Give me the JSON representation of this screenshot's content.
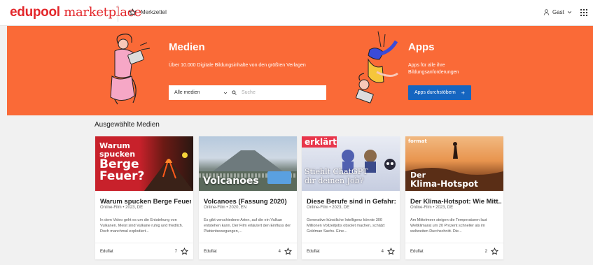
{
  "header": {
    "logo_part1": "edupool",
    "logo_part2": " marketplace",
    "bookmark_label": "Merkzettel",
    "user_label": "Gast"
  },
  "hero": {
    "media_title": "Medien",
    "media_subtitle": "Über 10.000 Digitale Bildungsinhalte von den größten Verlagen",
    "select_value": "Alle medien",
    "search_placeholder": "Suche",
    "apps_title": "Apps",
    "apps_subtitle": "Apps für alle ihre Bildungsanforderungen",
    "apps_button": "Apps durchstöbern",
    "apps_button_icon": "+",
    "color": "#fa6a37"
  },
  "section": {
    "title": "Ausgewählte Medien"
  },
  "cards": [
    {
      "title": "Warum spucken Berge Feuer?",
      "meta": "Online-Film • 2023, DE",
      "desc": "In dem Video geht es um die Entstehung von Vulkanen. Meist sind Vulkane ruhig und friedlich. Doch manchmal explodiert...",
      "provider": "Eduflat",
      "rating": "7",
      "thumb_text": "Warum spucken Berge Feuer?",
      "thumb_line1": "Warum",
      "thumb_line2": "spucken",
      "thumb_line3": "Berge",
      "thumb_line4": "Feuer?"
    },
    {
      "title": "Volcanoes (Fassung 2020)",
      "meta": "Online-Film • 2020, EN",
      "desc": "Es gibt verschiedene Arten, auf die ein Vulkan entstehen kann. Der Film erläutert den Einfluss der Plattenbewegungen,...",
      "provider": "Eduflat",
      "rating": "4",
      "thumb_text": "Volcanoes"
    },
    {
      "title": "Diese Berufe sind in Gefahr: ...",
      "meta": "Online-Film • 2023, DE",
      "desc": "Generative künstliche Intelligenz könnte 300 Millionen Vollzeitjobs obsolet machen, schätzt Goldman Sachs. Eine...",
      "provider": "Eduflat",
      "rating": "4",
      "thumb_badge": "erklärt",
      "thumb_line1": "Stiehlt ChatGPT",
      "thumb_line2": "dir deinen Job?"
    },
    {
      "title": "Der Klima-Hotspot: Wie Mitt...",
      "meta": "Online-Film • 2023, DE",
      "desc": "Am Mittelmeer steigen die Temperaturen laut Weltklimarat um 20 Prozent schneller als im weltweiten Durchschnitt. Die...",
      "provider": "Eduflat",
      "rating": "2",
      "thumb_badge": "format",
      "thumb_line1": "Der",
      "thumb_line2": "Klima-Hotspot"
    }
  ]
}
